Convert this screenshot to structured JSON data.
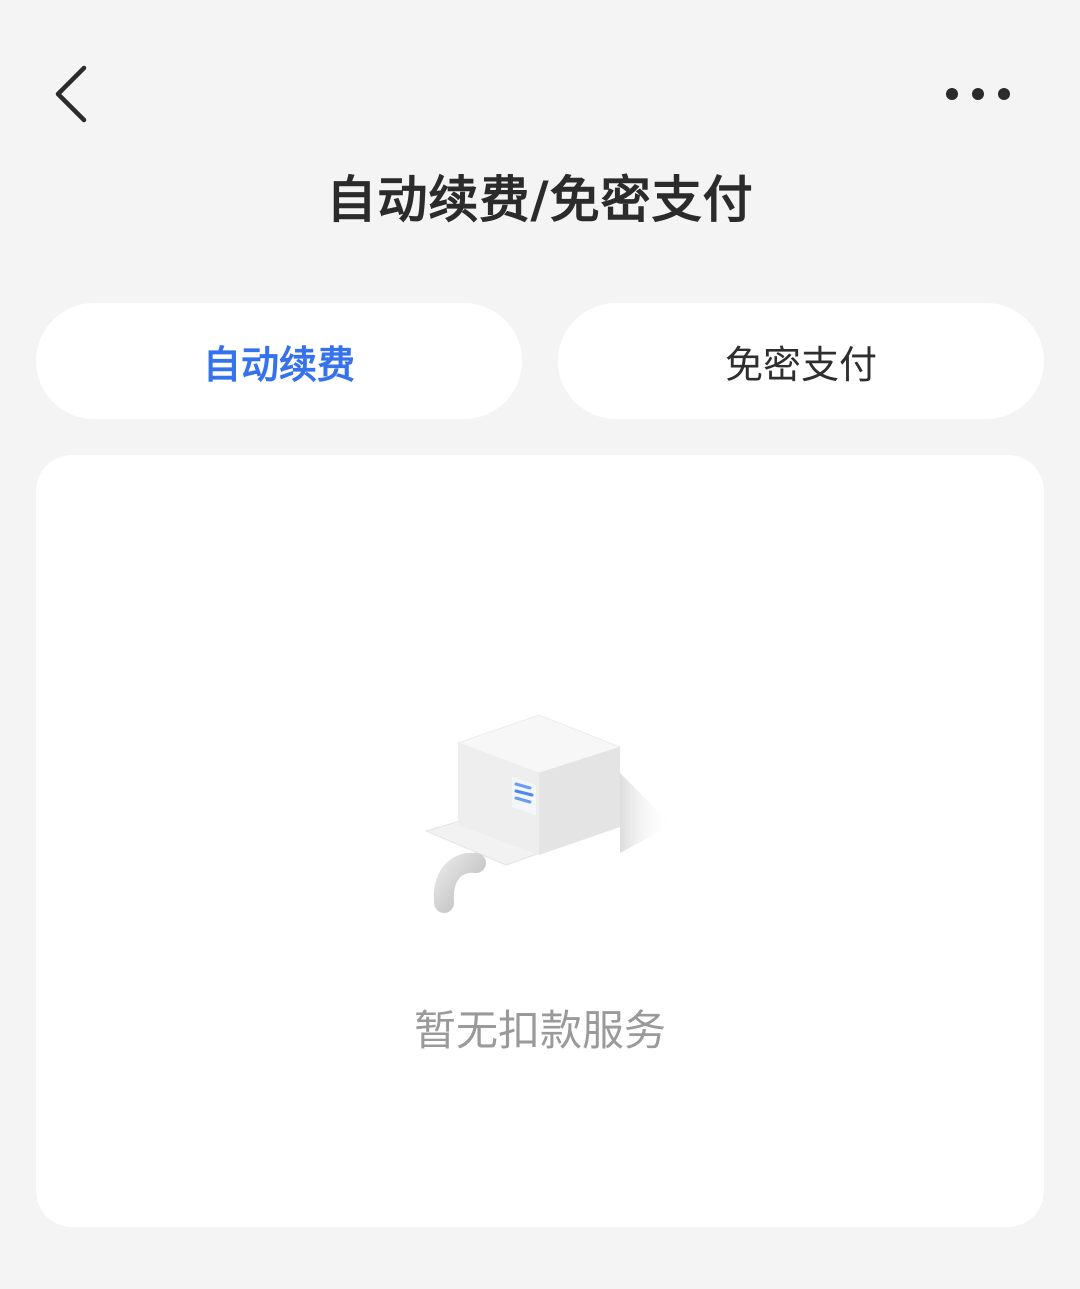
{
  "header": {
    "title": "自动续费/免密支付",
    "back_icon": "chevron-left-icon",
    "more_icon": "more-horizontal-icon"
  },
  "tabs": [
    {
      "label": "自动续费",
      "selected": true
    },
    {
      "label": "免密支付",
      "selected": false
    }
  ],
  "empty_state": {
    "icon": "empty-box-icon",
    "message": "暂无扣款服务"
  },
  "colors": {
    "accent": "#3572ec",
    "background": "#f4f4f4",
    "card": "#ffffff",
    "muted_text": "#9a9a9a"
  }
}
